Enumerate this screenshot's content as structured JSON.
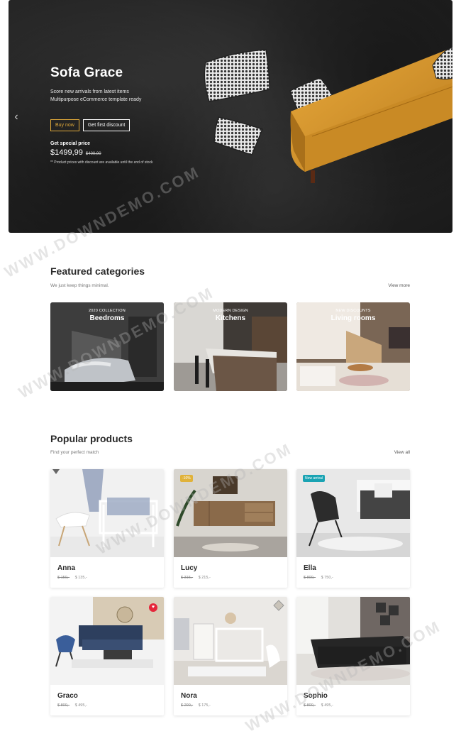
{
  "hero": {
    "title": "Sofa Grace",
    "subtitle_line1": "Score new arrivals from latest items",
    "subtitle_line2": "Multipurpose eCommerce template ready",
    "buy_label": "Buy now",
    "discount_label": "Get first discount",
    "special_label": "Get special price",
    "price": "$1499,99",
    "old_price": "$400,00",
    "note": "** Product prices with discount are available until the end of stock",
    "left_arrow": "‹",
    "right_arrow": "›",
    "accent": "#e0a93a"
  },
  "featured": {
    "title": "Featured categories",
    "subtitle": "We just keep things minimal.",
    "link": "View more",
    "cards": [
      {
        "tag": "2020 COLLECTION",
        "name": "Beedroms"
      },
      {
        "tag": "MODERN DESIGN",
        "name": "Kitchens"
      },
      {
        "tag": "NEW DISCOUNTS",
        "name": "Living rooms"
      }
    ]
  },
  "popular": {
    "title": "Popular products",
    "subtitle": "Find your perfect match",
    "link": "View all",
    "products": [
      {
        "name": "Anna",
        "old": "$ 150,-",
        "price": "$ 135,-"
      },
      {
        "name": "Lucy",
        "old": "$ 315,-",
        "price": "$ 215,-",
        "badge": "-10%"
      },
      {
        "name": "Ella",
        "old": "$ 800,-",
        "price": "$ 750,-",
        "badge": "New arrival"
      },
      {
        "name": "Graco",
        "old": "$ 800,-",
        "price": "$ 495,-"
      },
      {
        "name": "Nora",
        "old": "$ 200,-",
        "price": "$ 175,-"
      },
      {
        "name": "Sophio",
        "old": "$ 800,-",
        "price": "$ 495,-"
      }
    ]
  },
  "icons": {
    "heart": "♥"
  },
  "watermark": "WWW.DOWNDEMO.COM",
  "colors": {
    "badge_yellow": "#e0b23a",
    "badge_teal": "#1aa3b3",
    "heart_red": "#e5263a"
  }
}
